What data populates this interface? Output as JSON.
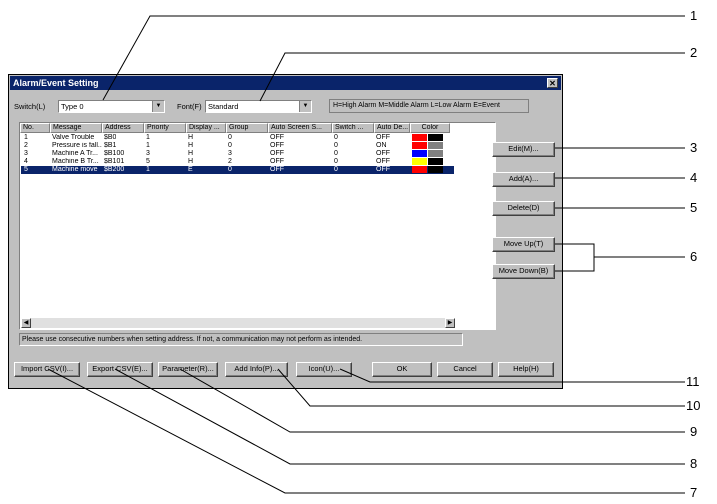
{
  "dialog": {
    "title": "Alarm/Event Setting",
    "close_glyph": "✕",
    "switch_label": "Switch(L)",
    "switch_value": "Type 0",
    "font_label": "Font(F)",
    "font_value": "Standard",
    "legend": "H=High Alarm M=Middle Alarm L=Low Alarm E=Event",
    "columns": [
      "No.",
      "Message",
      "Address",
      "Priority",
      "Display ...",
      "Group",
      "Auto Screen S...",
      "Switch ...",
      "Auto De...",
      "Color"
    ],
    "rows": [
      {
        "no": "1",
        "message": "Valve Trouble",
        "address": "$B0",
        "priority": "1",
        "display": "H",
        "group": "0",
        "auto_screen": "OFF",
        "switch": "0",
        "auto_de": "OFF",
        "colors": [
          "#ff0000",
          "#000000"
        ]
      },
      {
        "no": "2",
        "message": "Pressure is fall...",
        "address": "$B1",
        "priority": "1",
        "display": "H",
        "group": "0",
        "auto_screen": "OFF",
        "switch": "0",
        "auto_de": "ON",
        "colors": [
          "#ff0000",
          "#808080"
        ]
      },
      {
        "no": "3",
        "message": "Machine A Tr...",
        "address": "$B100",
        "priority": "3",
        "display": "H",
        "group": "3",
        "auto_screen": "OFF",
        "switch": "0",
        "auto_de": "OFF",
        "colors": [
          "#0000ff",
          "#808080"
        ]
      },
      {
        "no": "4",
        "message": "Machine B Tr...",
        "address": "$B101",
        "priority": "5",
        "display": "H",
        "group": "2",
        "auto_screen": "OFF",
        "switch": "0",
        "auto_de": "OFF",
        "colors": [
          "#ffff00",
          "#000000"
        ]
      },
      {
        "no": "5",
        "message": "Machine move",
        "address": "$B200",
        "priority": "1",
        "display": "E",
        "group": "0",
        "auto_screen": "OFF",
        "switch": "0",
        "auto_de": "OFF",
        "colors": [
          "#ff0000",
          "#000000"
        ]
      }
    ],
    "status_text": "Please use consecutive numbers when setting address. If not, a communication may not perform as intended.",
    "buttons": {
      "edit": "Edit(M)...",
      "add": "Add(A)...",
      "delete": "Delete(D)",
      "move_up": "Move Up(T)",
      "move_down": "Move Down(B)",
      "import_csv": "Import CSV(I)...",
      "export_csv": "Export CSV(E)...",
      "parameter": "Parameter(R)...",
      "add_info": "Add Info(P)...",
      "icon": "Icon(U)...",
      "ok": "OK",
      "cancel": "Cancel",
      "help": "Help(H)"
    }
  },
  "callouts": [
    "1",
    "2",
    "3",
    "4",
    "5",
    "6",
    "7",
    "8",
    "9",
    "10",
    "11"
  ]
}
